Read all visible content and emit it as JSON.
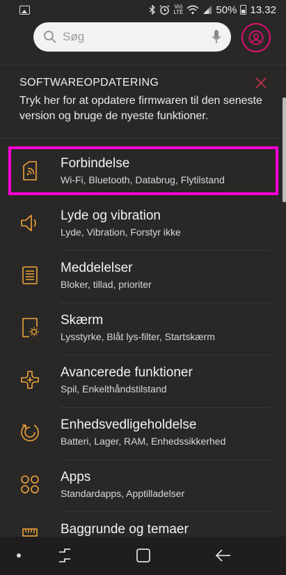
{
  "status_bar": {
    "battery": "50%",
    "time": "13.32",
    "network_top": "Vo)",
    "network_bottom": "LTE"
  },
  "search": {
    "placeholder": "Søg"
  },
  "update_card": {
    "title": "SOFTWAREOPDATERING",
    "text": "Tryk her for at opdatere firmwaren til den seneste version og bruge de nyeste funktioner."
  },
  "settings": [
    {
      "title": "Forbindelse",
      "subtitle": "Wi-Fi, Bluetooth, Databrug, Flytilstand",
      "icon": "connections-icon"
    },
    {
      "title": "Lyde og vibration",
      "subtitle": "Lyde, Vibration, Forstyr ikke",
      "icon": "sound-icon"
    },
    {
      "title": "Meddelelser",
      "subtitle": "Bloker, tillad, prioriter",
      "icon": "notifications-icon"
    },
    {
      "title": "Skærm",
      "subtitle": "Lysstyrke, Blåt lys-filter, Startskærm",
      "icon": "display-icon"
    },
    {
      "title": "Avancerede funktioner",
      "subtitle": "Spil, Enkelthåndstilstand",
      "icon": "advanced-features-icon"
    },
    {
      "title": "Enhedsvedligeholdelse",
      "subtitle": "Batteri, Lager, RAM, Enhedssikkerhed",
      "icon": "device-maintenance-icon"
    },
    {
      "title": "Apps",
      "subtitle": "Standardapps, Apptilladelser",
      "icon": "apps-icon"
    },
    {
      "title": "Baggrunde og temaer",
      "subtitle": "",
      "icon": "wallpapers-icon"
    }
  ],
  "colors": {
    "accent": "#f0a53c",
    "highlight": "#ff00d4",
    "avatar_ring": "#e0116f",
    "background": "#2a2727"
  }
}
